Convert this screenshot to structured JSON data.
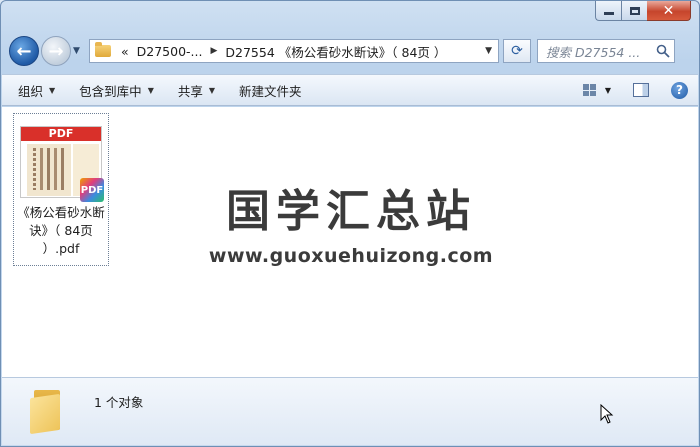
{
  "window": {
    "buttons": {
      "minimize": "minimize-icon",
      "maximize": "maximize-icon",
      "close": "close-icon"
    },
    "close_glyph": "✕"
  },
  "nav": {
    "back_glyph": "←",
    "forward_glyph": "→",
    "breadcrumb": {
      "prefix": "«",
      "items": [
        "D27500-...",
        "D27554 《杨公看砂水断诀》（ 84页 ）"
      ]
    },
    "refresh_glyph": "⟳",
    "search": {
      "placeholder": "搜索 D27554 ..."
    }
  },
  "toolbar": {
    "organize": "组织",
    "include_in_library": "包含到库中",
    "share": "共享",
    "new_folder": "新建文件夹",
    "help": "?"
  },
  "files": [
    {
      "name": "《杨公看砂水断诀》（ 84页 ）.pdf",
      "thumb_banner": "PDF",
      "badge": "PDF"
    }
  ],
  "watermark": {
    "title": "国学汇总站",
    "url": "www.guoxuehuizong.com"
  },
  "details": {
    "count_text": "1 个对象"
  },
  "colors": {
    "pdf_red": "#d9302a",
    "accent": "#1f5aa6"
  }
}
